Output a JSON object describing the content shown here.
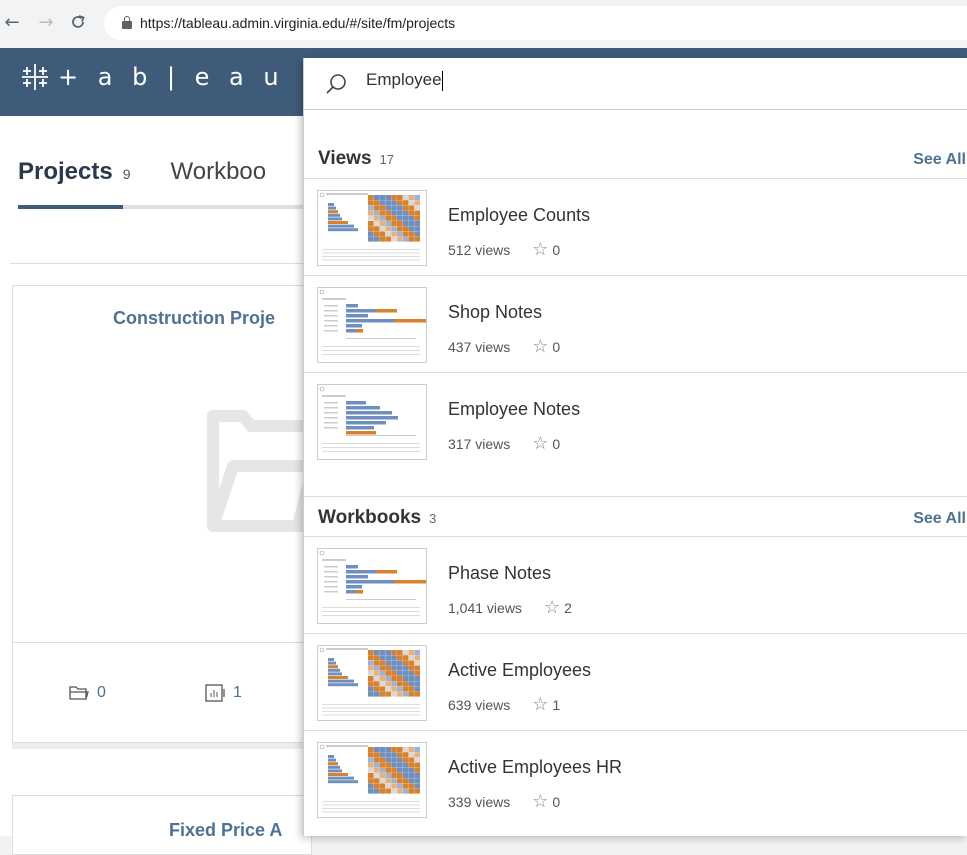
{
  "browser": {
    "back": "←",
    "forward": "→",
    "reload": "C",
    "url": "https://tableau.admin.virginia.edu/#/site/fm/projects"
  },
  "header": {
    "logo_text": "+ a b | e a u",
    "brand_color": "#3e5c7a"
  },
  "tabs": {
    "projects_label": "Projects",
    "projects_count": "9",
    "workbooks_label": "Workboo"
  },
  "cards": [
    {
      "title": "Construction Proje",
      "folders": "0",
      "workbooks": "1"
    },
    {
      "title": "Fixed Price A"
    }
  ],
  "search": {
    "query": "Employee",
    "views": {
      "title": "Views",
      "count": "17",
      "see_all": "See All",
      "items": [
        {
          "title": "Employee Counts",
          "views": "512 views",
          "favorites": "0",
          "thumb": "heatmap"
        },
        {
          "title": "Shop Notes",
          "views": "437 views",
          "favorites": "0",
          "thumb": "bars"
        },
        {
          "title": "Employee Notes",
          "views": "317 views",
          "favorites": "0",
          "thumb": "bars-blue"
        }
      ]
    },
    "workbooks": {
      "title": "Workbooks",
      "count": "3",
      "see_all": "See All",
      "items": [
        {
          "title": "Phase Notes",
          "views": "1,041 views",
          "favorites": "2",
          "thumb": "bars"
        },
        {
          "title": "Active Employees",
          "views": "639 views",
          "favorites": "1",
          "thumb": "heatmap"
        },
        {
          "title": "Active Employees HR",
          "views": "339 views",
          "favorites": "0",
          "thumb": "heatmap"
        }
      ]
    }
  },
  "colors": {
    "link": "#4e7294",
    "thumb_blue": "#6f8fbf",
    "thumb_orange": "#d9822b"
  }
}
